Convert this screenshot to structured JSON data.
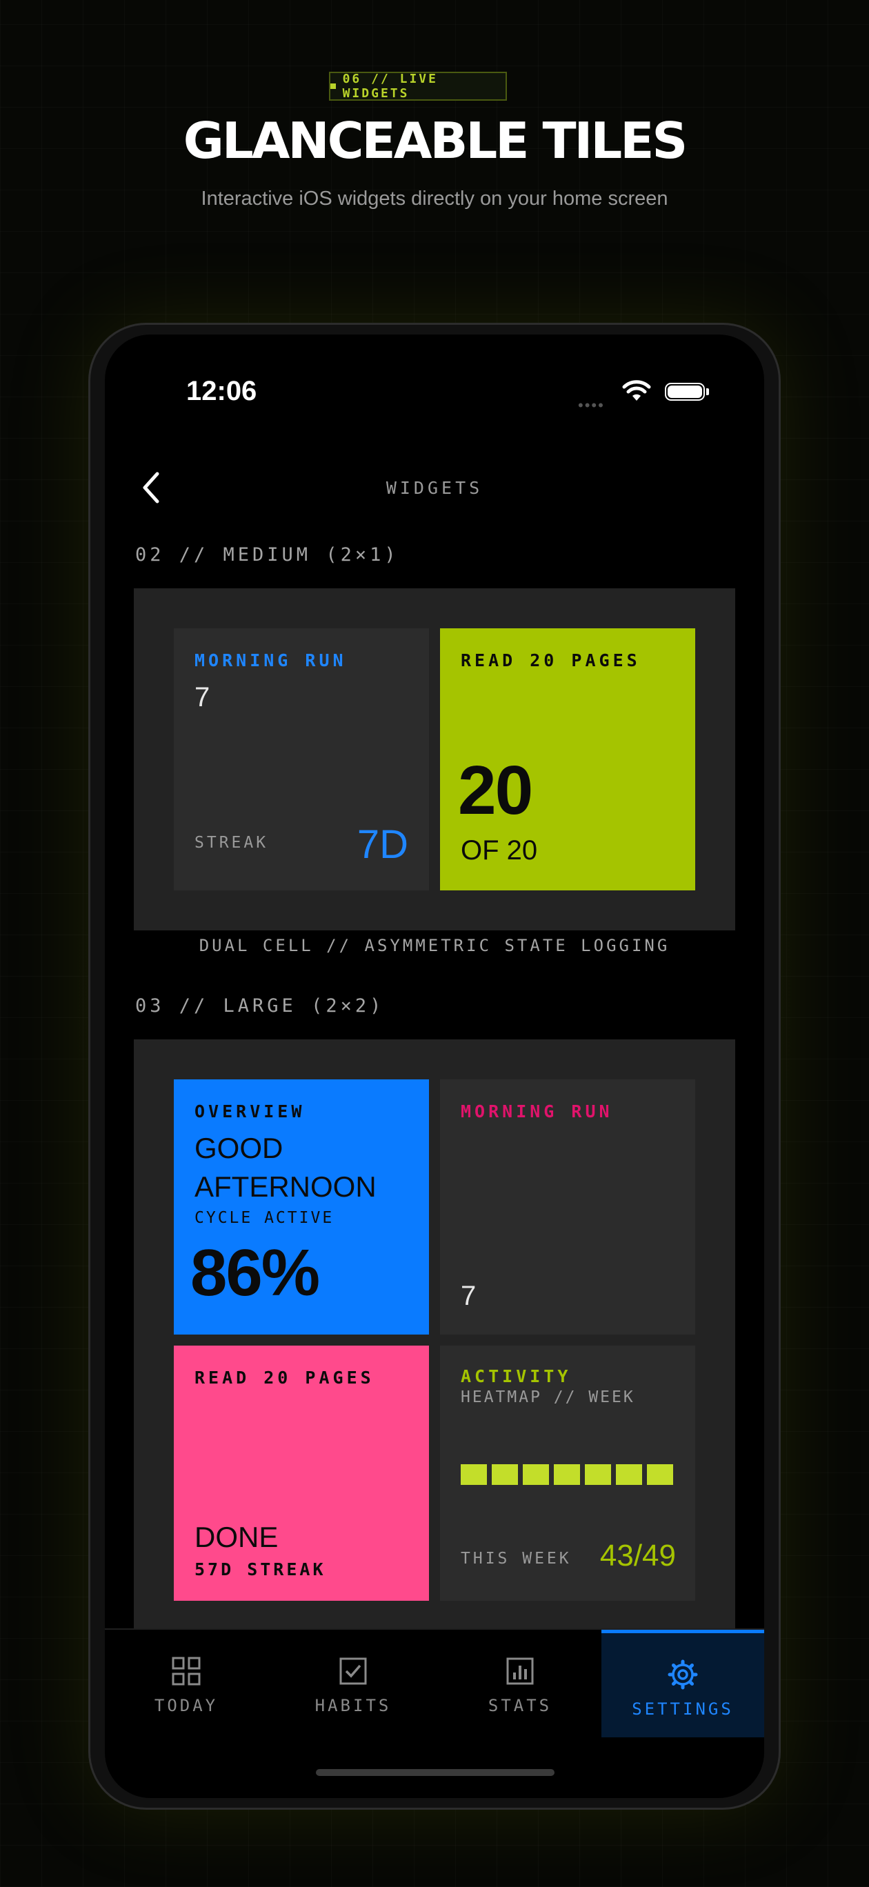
{
  "header": {
    "badge": "06 // LIVE WIDGETS",
    "title": "GLANCEABLE TILES",
    "subtitle": "Interactive iOS widgets directly on your home screen"
  },
  "status_bar": {
    "time": "12:06",
    "signal": "••••"
  },
  "nav": {
    "title": "WIDGETS"
  },
  "colors": {
    "lime": "#a5c400",
    "blue": "#0a7bff",
    "pink": "#ff4a8c",
    "tile_dark": "#2c2c2c",
    "panel": "#232323"
  },
  "medium": {
    "section_label": "02 // MEDIUM (2×1)",
    "left": {
      "title": "MORNING RUN",
      "value": "7",
      "streak_label": "STREAK",
      "streak_value": "7D"
    },
    "right": {
      "title": "READ 20 PAGES",
      "value": "20",
      "sub": "OF 20"
    },
    "caption": "DUAL CELL // ASYMMETRIC STATE LOGGING"
  },
  "large": {
    "section_label": "03 // LARGE (2×2)",
    "overview": {
      "title": "OVERVIEW",
      "greeting_line1": "GOOD",
      "greeting_line2": "AFTERNOON",
      "cycle": "CYCLE ACTIVE",
      "percent": "86%"
    },
    "run": {
      "title": "MORNING RUN",
      "value": "7"
    },
    "read": {
      "title": "READ 20 PAGES",
      "status": "DONE",
      "streak": "57D STREAK"
    },
    "activity": {
      "title": "ACTIVITY",
      "subtitle": "HEATMAP // WEEK",
      "week_label": "THIS WEEK",
      "week_value": "43/49",
      "days_completed": 7
    }
  },
  "tabs": [
    {
      "label": "TODAY",
      "icon": "grid-icon"
    },
    {
      "label": "HABITS",
      "icon": "checkbox-icon"
    },
    {
      "label": "STATS",
      "icon": "chart-icon"
    },
    {
      "label": "SETTINGS",
      "icon": "gear-icon",
      "active": true
    }
  ]
}
